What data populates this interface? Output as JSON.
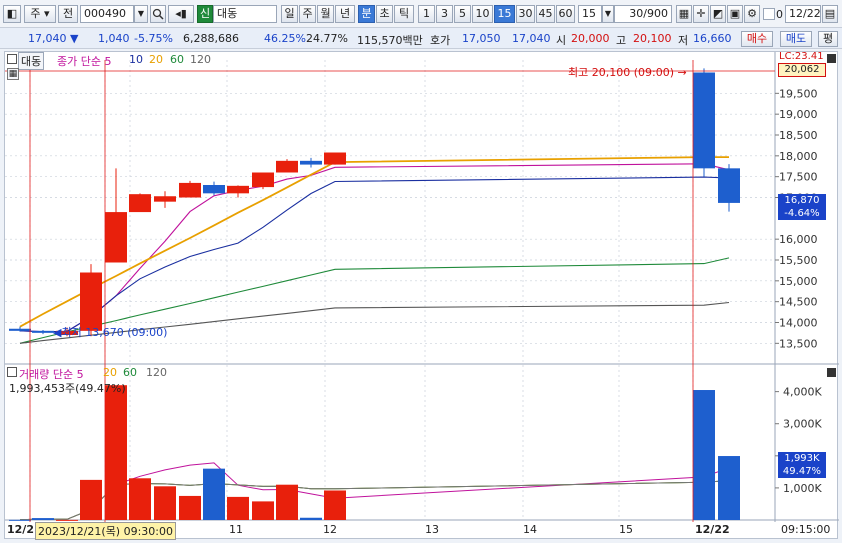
{
  "toolbar": {
    "market_label": "주",
    "jeon_label": "전",
    "stock_code": "000490",
    "signal_badge": "신",
    "stock_name": "대동",
    "period_buttons": [
      "일",
      "주",
      "월",
      "년",
      "분",
      "초",
      "틱"
    ],
    "selected_period": "분",
    "interval_buttons": [
      "1",
      "3",
      "5",
      "10",
      "15",
      "30",
      "45",
      "60"
    ],
    "selected_interval": "15",
    "interval_select": "15",
    "count_value": "30",
    "count_max": "/900",
    "checkbox_zero": "0",
    "date_value": "12/22"
  },
  "quote": {
    "price": "17,040",
    "change_arrow": "▼",
    "change": "1,040",
    "change_pct": "-5.75%",
    "volume": "6,288,686",
    "vol_ratio": "46.25%",
    "turnover": "24.77%",
    "amount": "115,570백만",
    "ask_label": "호가",
    "ask": "17,050",
    "bid": "17,040",
    "open_label": "시",
    "open": "20,000",
    "high_label": "고",
    "high": "20,100",
    "low_label": "저",
    "low": "16,660",
    "buy_button": "매수",
    "sell_button": "매도",
    "eval_button": "평"
  },
  "price_panel": {
    "stock_tag": "대동",
    "ma_label": "종가 단순",
    "ma_periods": [
      "5",
      "10",
      "20",
      "60",
      "120"
    ],
    "ma_colors": [
      "#c0129c",
      "#1a2fa0",
      "#e8a000",
      "#1f8a3a",
      "#555555"
    ],
    "high_annotation": "최고 20,100 (09:00)",
    "low_annotation": "최저 13,670 (09:00)",
    "lc_label": "LC:23.41",
    "top_price_tag": "20,062",
    "current_price_tag": "16,870",
    "current_pct_tag": "-4.64%",
    "y_ticks": [
      "19,500",
      "19,000",
      "18,500",
      "18,000",
      "17,500",
      "17,000",
      "16,000",
      "15,500",
      "15,000",
      "14,500",
      "14,000",
      "13,500"
    ]
  },
  "volume_panel": {
    "label": "거래량 단순",
    "ma_periods": [
      "5",
      "20",
      "60",
      "120"
    ],
    "last_value": "1,993,453주(49.47%)",
    "vol_tag": "1,993K",
    "vol_pct_tag": "49.47%",
    "y_ticks": [
      "4,000K",
      "3,000K",
      "2,000K",
      "1,000K"
    ]
  },
  "x_axis": {
    "labels": [
      "12/2",
      "11",
      "12",
      "13",
      "14",
      "15",
      "12/22"
    ],
    "cursor_label": "2023/12/21(목) 09:30:00",
    "time_label": "09:15:00"
  },
  "chart_data": {
    "type": "candlestick",
    "candles": [
      {
        "o": 13850,
        "h": 13900,
        "l": 13780,
        "c": 13800
      },
      {
        "o": 13800,
        "h": 13820,
        "l": 13720,
        "c": 13760
      },
      {
        "o": 13700,
        "h": 13880,
        "l": 13670,
        "c": 13800
      },
      {
        "o": 13800,
        "h": 15400,
        "l": 13670,
        "c": 15200
      },
      {
        "o": 15440,
        "h": 17700,
        "l": 15440,
        "c": 16650
      },
      {
        "o": 16650,
        "h": 17100,
        "l": 16850,
        "c": 17080
      },
      {
        "o": 16900,
        "h": 17150,
        "l": 16750,
        "c": 17030
      },
      {
        "o": 17000,
        "h": 17400,
        "l": 17000,
        "c": 17350
      },
      {
        "o": 17300,
        "h": 17380,
        "l": 17050,
        "c": 17100
      },
      {
        "o": 17100,
        "h": 17290,
        "l": 17000,
        "c": 17280
      },
      {
        "o": 17250,
        "h": 17600,
        "l": 17200,
        "c": 17600
      },
      {
        "o": 17600,
        "h": 17920,
        "l": 17600,
        "c": 17880
      },
      {
        "o": 17880,
        "h": 17950,
        "l": 17720,
        "c": 17790
      },
      {
        "o": 17790,
        "h": 18080,
        "l": 17790,
        "c": 18080
      },
      {
        "o": 20000,
        "h": 20100,
        "l": 17500,
        "c": 17700
      },
      {
        "o": 17700,
        "h": 17800,
        "l": 16660,
        "c": 16870
      }
    ],
    "volume": [
      5,
      60,
      4,
      1250,
      4200,
      1300,
      1050,
      750,
      1600,
      720,
      580,
      1100,
      70,
      920,
      4050,
      1993
    ],
    "ylim": [
      13100,
      20300
    ],
    "vol_ylim": [
      0,
      4300
    ]
  }
}
